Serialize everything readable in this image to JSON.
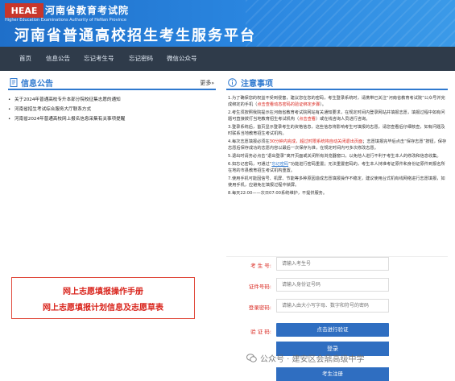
{
  "header": {
    "logo_text": "HEAE",
    "org_name": "河南省教育考试院",
    "org_name_en": "Higher Education Examinations Authority of HeNan Province",
    "site_title": "河南省普通高校招生考生服务平台"
  },
  "nav": {
    "items": [
      {
        "label": "首页"
      },
      {
        "label": "信息公告"
      },
      {
        "label": "忘记考生号"
      },
      {
        "label": "忘记密码"
      },
      {
        "label": "微信公众号"
      }
    ]
  },
  "news": {
    "title": "信息公告",
    "more_label": "更多",
    "more_arrow": "»",
    "items": [
      {
        "text": "关于2024年普通高校专升本部分院校征集志愿的通知"
      },
      {
        "text": "河南省招生考试综合服务大厅联系方式"
      },
      {
        "text": "河南省2024年普通高校网上报名信息采集有关事项提醒"
      }
    ]
  },
  "banner": {
    "line1": "网上志愿填报操作手册",
    "line2": "网上志愿填报计划信息及志愿草表"
  },
  "notice": {
    "title": "注意事项",
    "items": [
      {
        "a": "1.为了确保您的权益不受到侵害，建议您在您的密码，考生登录系统时，请携带已关注“河南省教育考试院”公众号并完成绑定的手机（",
        "b": "点击查看动态密码的验证绑定步骤",
        "c": "）。"
      },
      {
        "a": "2.考生须按照我院提示在河南省教育考试院网站有关通知要求，在规定时间内登录网站并填报志愿，填报过程中如有问题可直接拨打当地教育招生考试机构（",
        "b": "点击查看",
        "c": "）或在线咨询人员进行咨询。"
      },
      {
        "a": "3.登录系统后，首页显示登录考生的资格信息，这些信息将影响考生可填报的志愿，请您查看后仔细核查，如有问题及时联系当地教育招生考试机构。",
        "b": "",
        "c": ""
      },
      {
        "a": "4.每次志愿填报必须在",
        "b": "30分钟内完成，超过时限系统将自动关闭退出页面",
        "c": "；志愿填报完毕后点击“保存志愿”按钮，保存志愿后保存成功的志愿内容以最后一次保存为准，在规定时间内可多次修改志愿。"
      },
      {
        "a": "5.退出时请务必点击“退出登录”离开页面或关闭所有浏览器窗口，以免他人进行不利于考生本人的修改和信息收集。",
        "b": "",
        "c": ""
      },
      {
        "a": "6.如忘记密码，可通过“",
        "b": "忘记密码",
        "c": "”功能进行密码重置；无法重置密码的，考生本人持准考证原件和身份证原件到报名所在地的市县教育招生考试机构重置。"
      },
      {
        "a": "7.使用手机可能因信号、机屏、节能等多种原因造成志愿填报操作不稳定，建议使用台式机有线网络进行志愿填报，如使用手机，应避免在填报过程中锁屏。",
        "b": "",
        "c": ""
      },
      {
        "a": "8.每天22:00——次日07:00系统维护，不提供服务。",
        "b": "",
        "c": ""
      }
    ]
  },
  "form": {
    "exam_no_label": "考 生 号:",
    "exam_no_placeholder": "请输入考生号",
    "id_label": "证件号码:",
    "id_placeholder": "请输入身份证号码",
    "password_label": "登录密码:",
    "password_placeholder": "请输入由大小写字母、数字和符号的密码",
    "verify_label": "验 证 码:",
    "verify_button": "点击进行验证",
    "login_button": "登录",
    "register_button": "考生注册"
  },
  "watermark": {
    "text": "公众号 · 建安区会鼎高级中学"
  },
  "colors": {
    "header_blue": "#2a86e0",
    "nav_dark": "#2f3b4a",
    "accent_blue": "#2f79cf",
    "button_blue": "#2f6ec1",
    "alert_red": "#d9251d"
  }
}
